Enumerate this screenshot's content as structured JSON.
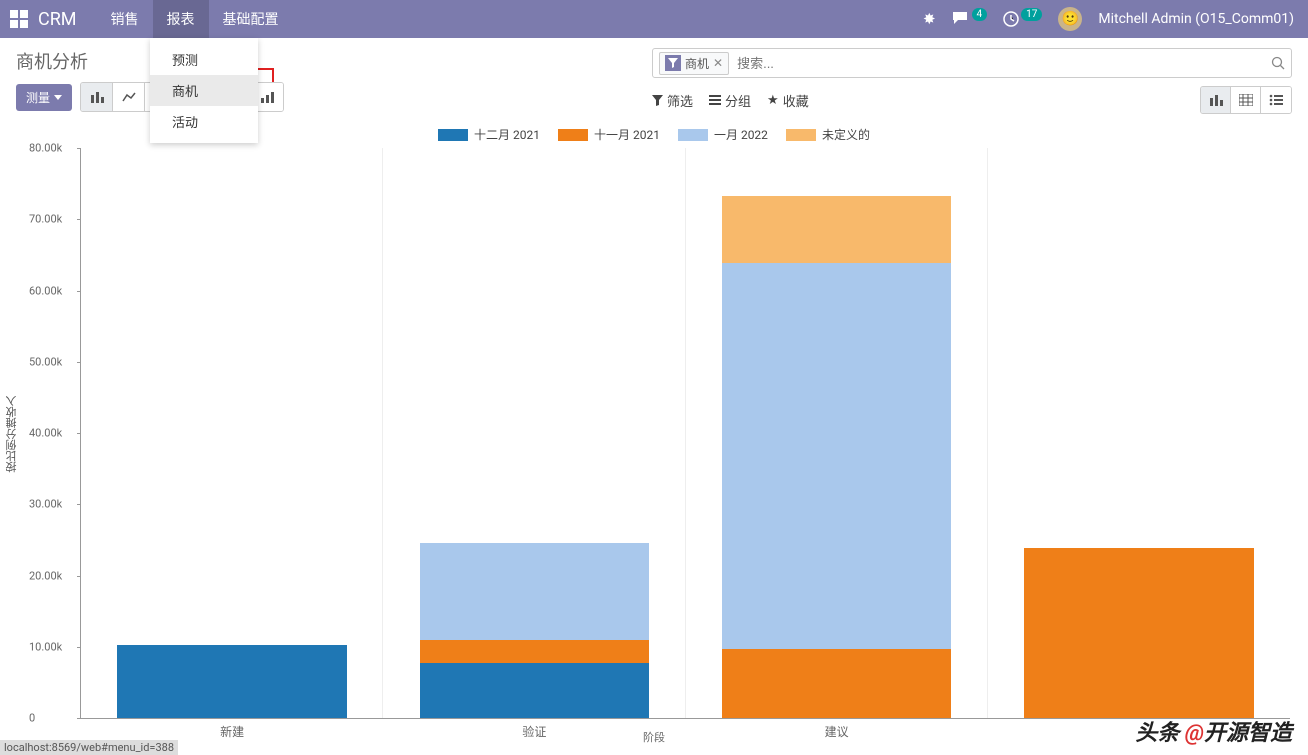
{
  "nav": {
    "brand": "CRM",
    "items": [
      "销售",
      "报表",
      "基础配置"
    ],
    "active_index": 1,
    "msg_badge": "4",
    "clock_badge": "17",
    "user": "Mitchell Admin (O15_Comm01)"
  },
  "dropdown": {
    "items": [
      "预测",
      "商机",
      "活动"
    ],
    "highlight_index": 1
  },
  "page": {
    "title": "商机分析",
    "measure_btn": "测量"
  },
  "search": {
    "chip": "商机",
    "placeholder": "搜索..."
  },
  "filters": {
    "filter": "筛选",
    "group": "分组",
    "fav": "收藏"
  },
  "colors": {
    "s0": "#1f77b4",
    "s1": "#ef7f18",
    "s2": "#a9c8ec",
    "s3": "#f8b96b"
  },
  "chart_data": {
    "type": "bar",
    "stacked": true,
    "ylabel": "按比例分摊收入",
    "xlabel": "阶段",
    "ylim": [
      0,
      80000
    ],
    "ytick_step": 10000,
    "yticks": [
      "0",
      "10.00k",
      "20.00k",
      "30.00k",
      "40.00k",
      "50.00k",
      "60.00k",
      "70.00k",
      "80.00k"
    ],
    "categories": [
      "新建",
      "验证",
      "建议",
      ""
    ],
    "series": [
      {
        "name": "十二月 2021",
        "color_key": "s0",
        "values": [
          10300,
          7700,
          0,
          0
        ]
      },
      {
        "name": "十一月 2021",
        "color_key": "s1",
        "values": [
          0,
          3300,
          9700,
          23800
        ]
      },
      {
        "name": "一月 2022",
        "color_key": "s2",
        "values": [
          0,
          13500,
          54200,
          0
        ]
      },
      {
        "name": "未定义的",
        "color_key": "s3",
        "values": [
          0,
          0,
          9300,
          0
        ]
      }
    ]
  },
  "watermark": {
    "prefix": "头条 ",
    "at": "@",
    "name": "开源智造"
  },
  "status": "localhost:8569/web#menu_id=388"
}
